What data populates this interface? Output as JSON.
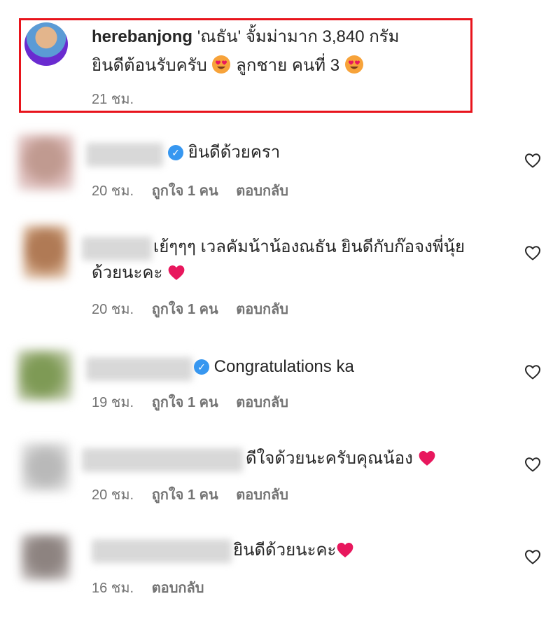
{
  "top_comment": {
    "username": "herebanjong",
    "text_line1": "'ณธัน' จั้มม่ามาก 3,840 กรัม",
    "text_line2_a": "ยินดีต้อนรับครับ",
    "text_line2_b": "ลูกชาย คนที่ 3",
    "time": "21 ชม."
  },
  "comments": [
    {
      "text": "ยินดีด้วยครา",
      "time": "20 ชม.",
      "likes": "ถูกใจ 1 คน",
      "reply": "ตอบกลับ",
      "verified": true
    },
    {
      "text_line1": "เย้ๆๆๆ เวลคัมน้าน้องณธัน ยินดีกับก๊อจงพี่นุ้ย",
      "text_line2": "ด้วยนะคะ",
      "time": "20 ชม.",
      "likes": "ถูกใจ 1 คน",
      "reply": "ตอบกลับ",
      "verified": false
    },
    {
      "text": "Congratulations ka",
      "time": "19 ชม.",
      "likes": "ถูกใจ 1 คน",
      "reply": "ตอบกลับ",
      "verified": true
    },
    {
      "text": "ดีใจด้วยนะครับคุณน้อง",
      "time": "20 ชม.",
      "likes": "ถูกใจ 1 คน",
      "reply": "ตอบกลับ",
      "verified": false
    },
    {
      "text": "ยินดีด้วยนะคะ",
      "time": "16 ชม.",
      "reply": "ตอบกลับ",
      "verified": false
    }
  ],
  "icons": {
    "like": "heart-outline-icon",
    "verified": "verified-badge-icon",
    "heart_eyes": "heart-eyes-emoji",
    "red_heart": "red-heart-emoji"
  },
  "colors": {
    "highlight": "#e8141c",
    "verified": "#3797f0",
    "heart": "#e8175d",
    "meta": "#737373"
  }
}
